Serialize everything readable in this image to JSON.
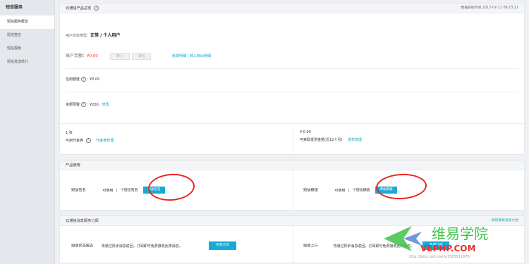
{
  "sidebar": {
    "title": "短信服务",
    "items": [
      {
        "label": "短信服务概览"
      },
      {
        "label": "短信签名"
      },
      {
        "label": "短信模板"
      },
      {
        "label": "短信发送统计"
      }
    ]
  },
  "account": {
    "title": "云通信产品总览",
    "data_time": "数据获取时间:2017-07-11 09:23:21",
    "user_status_label": "用户状态类型：",
    "user_status_value": "正常 / 个人用户",
    "balance_label": "账户余额：",
    "balance_value": "¥0.00",
    "transfer_in": "转入",
    "transfer_out": "转出",
    "balance_links": "账单明细 | 转入转出明细",
    "credit_label": "信用额度",
    "credit_value": "：¥0.00",
    "alert_label": "余额预警",
    "alert_value": "：¥200，",
    "alert_edit": "修改",
    "coupon_count": "1 张",
    "coupon_label": "可用代金券",
    "coupon_link": "代金券管理",
    "invoice_amount": "¥ 0.00",
    "invoice_label": "可索取发票金额(近12个月)",
    "invoice_link": "发票管理"
  },
  "products": {
    "title": "产品使用",
    "sign_label": "短信签名",
    "sign_usable": "可使用",
    "sign_count": "1",
    "sign_unit": "个短信签名",
    "sign_button": "添加签名",
    "tpl_label": "短信模版",
    "tpl_usable": "可使用",
    "tpl_count": "1",
    "tpl_unit": "个短信模板",
    "tpl_button": "添加模板"
  },
  "subscription": {
    "title": "云通信消息服务订阅",
    "doc_link": "如何接收消息文档",
    "report_label": "短信状态报告",
    "report_desc": "将通过异步消息返回，订阅即可免费接收此类消息。",
    "report_button": "免费订阅",
    "upstream_label": "短信上行",
    "upstream_desc": "将通过异步消息返回，订阅即可免费接收此类消息。",
    "upstream_button": "免费订阅"
  },
  "watermark": {
    "brand_cn": "维易学院",
    "brand_en": "VEPHP.COM",
    "url": "http://blog.csdn.net/a1583011678",
    "colors": {
      "green": "#3ec24a",
      "red": "#e5322d",
      "blue": "#2f6fc9"
    }
  },
  "annotation_color": "#e22222"
}
